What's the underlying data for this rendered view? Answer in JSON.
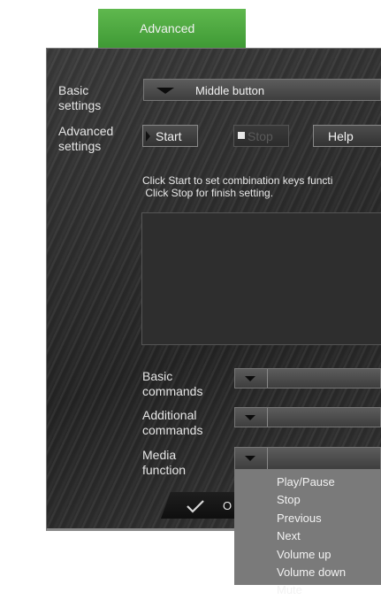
{
  "tab": {
    "label": "Advanced"
  },
  "basic_settings": {
    "label_line1": "Basic",
    "label_line2": "settings",
    "selected": "Middle button"
  },
  "advanced_settings": {
    "label_line1": "Advanced",
    "label_line2": "settings",
    "start_label": "Start",
    "stop_label": "Stop",
    "help_label": "Help"
  },
  "instructions": {
    "line1": "Click Start to set combination keys functi",
    "line2": " Click Stop for finish setting."
  },
  "basic_commands": {
    "label_line1": "Basic",
    "label_line2": "commands",
    "selected": ""
  },
  "additional_commands": {
    "label_line1": "Additional",
    "label_line2": "commands",
    "selected": ""
  },
  "media_function": {
    "label_line1": "Media",
    "label_line2": "function",
    "selected": "",
    "options": [
      "Play/Pause",
      "Stop",
      "Previous",
      "Next",
      "Volume up",
      "Volume down",
      "Mute"
    ]
  },
  "ok_button": {
    "label": "O"
  },
  "colors": {
    "tab_green": "#4caf42",
    "panel": "#2c2c2c",
    "menu_bg": "#7a7a7a"
  }
}
